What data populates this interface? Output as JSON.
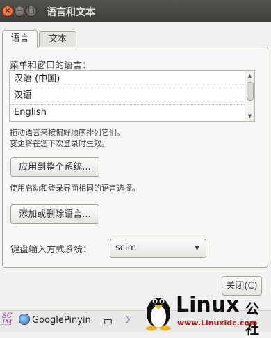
{
  "window": {
    "title": "语言和文本"
  },
  "window_controls": {
    "close": "×",
    "minimize": "−",
    "maximize": "□"
  },
  "tabs": [
    {
      "label": "语言",
      "active": true
    },
    {
      "label": "文本",
      "active": false
    }
  ],
  "language": {
    "menu_label": "菜单和窗口的语言：",
    "items": [
      "汉语 (中国)",
      "汉语",
      "English"
    ],
    "hint_line1": "拖动语言来按偏好顺序排列它们。",
    "hint_line2": "变更将在您下次登录时生效。",
    "apply_button": "应用到整个系统...",
    "apply_hint": "使用启动和登录界面相同的语言选择。",
    "add_remove_button": "添加或删除语言...",
    "keyboard_label": "键盘输入方式系统：",
    "keyboard_value": "scim"
  },
  "close_button": "关闭(C)",
  "taskbar": {
    "logo": "SCIM",
    "input_method": "GooglePinyin",
    "mode": "中",
    "moon": "☽"
  },
  "watermark": {
    "brand": "Linux",
    "cn": "公社",
    "url": "www.Linuxidc.com"
  }
}
